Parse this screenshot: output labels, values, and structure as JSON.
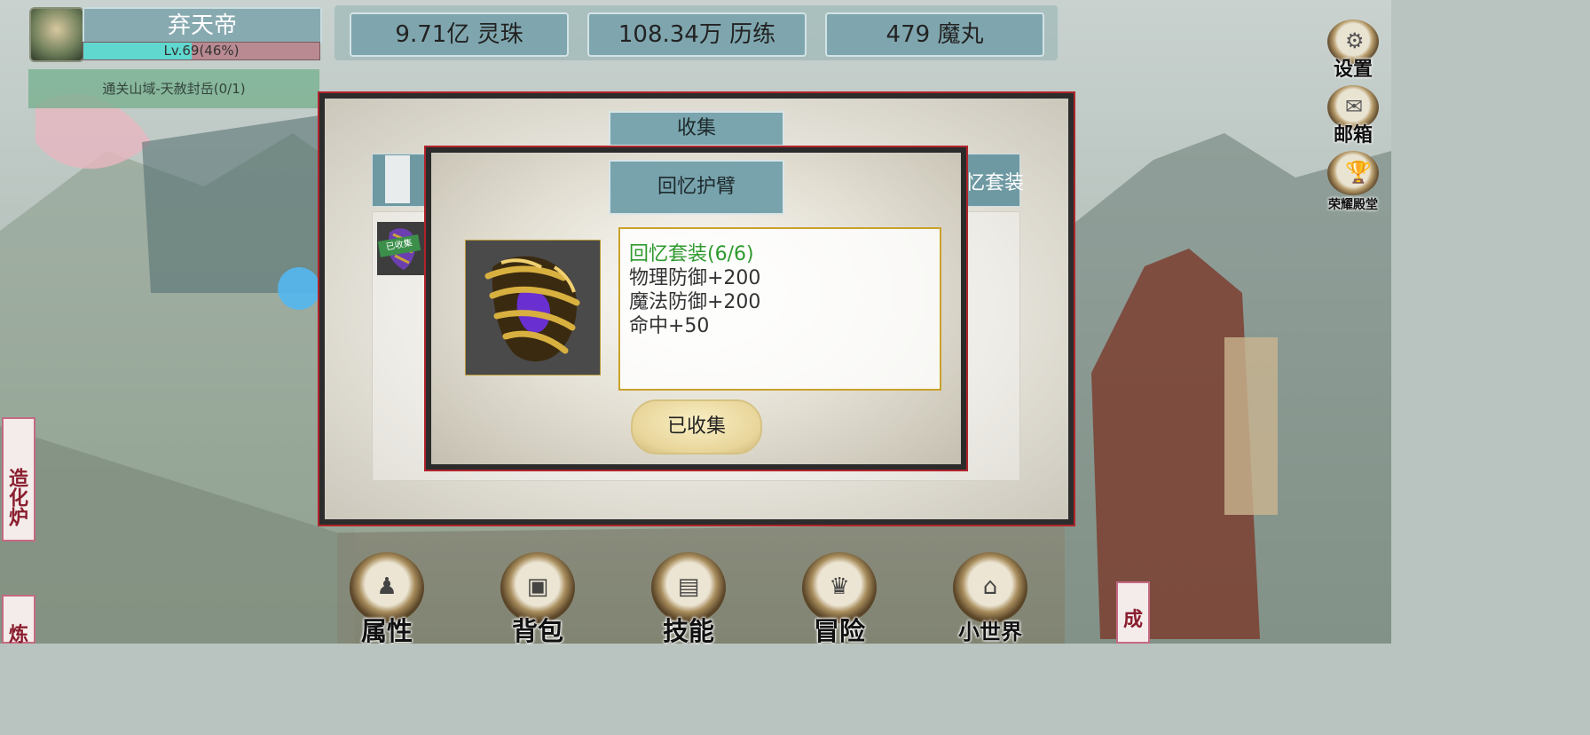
{
  "player": {
    "name": "弃天帝",
    "level_text": "Lv.69(46%)",
    "level_progress": 0.46
  },
  "quest": {
    "text": "通关山域-天赦封岳(0/1)"
  },
  "resources": [
    {
      "label": "9.71亿 灵珠"
    },
    {
      "label": "108.34万 历练"
    },
    {
      "label": "479 魔丸"
    }
  ],
  "side_menu": [
    {
      "label": "设置",
      "icon": "gear-icon"
    },
    {
      "label": "邮箱",
      "icon": "mail-icon"
    },
    {
      "label": "荣耀殿堂",
      "icon": "trophy-icon"
    }
  ],
  "left_menu": [
    {
      "label": "造化炉"
    },
    {
      "label": "炼"
    }
  ],
  "right_bottom": {
    "label": "成"
  },
  "bottom_nav": [
    {
      "label": "属性",
      "icon": "attributes-icon"
    },
    {
      "label": "背包",
      "icon": "bag-icon"
    },
    {
      "label": "技能",
      "icon": "skills-icon"
    },
    {
      "label": "冒险",
      "icon": "adventure-icon"
    },
    {
      "label": "小世界",
      "icon": "world-icon"
    }
  ],
  "collection": {
    "title": "收集",
    "tab_visible_text": "忆套装",
    "list_badge": "已收集"
  },
  "item_popup": {
    "title": "回忆护臂",
    "set_name": "回忆套装(6/6)",
    "stats": [
      "物理防御+200",
      "魔法防御+200",
      "命中+50"
    ],
    "button": "已收集"
  },
  "colors": {
    "set_name": "#2e9a2e",
    "modal_border": "#b0242a",
    "teal_panel": "#7aa5ae"
  }
}
